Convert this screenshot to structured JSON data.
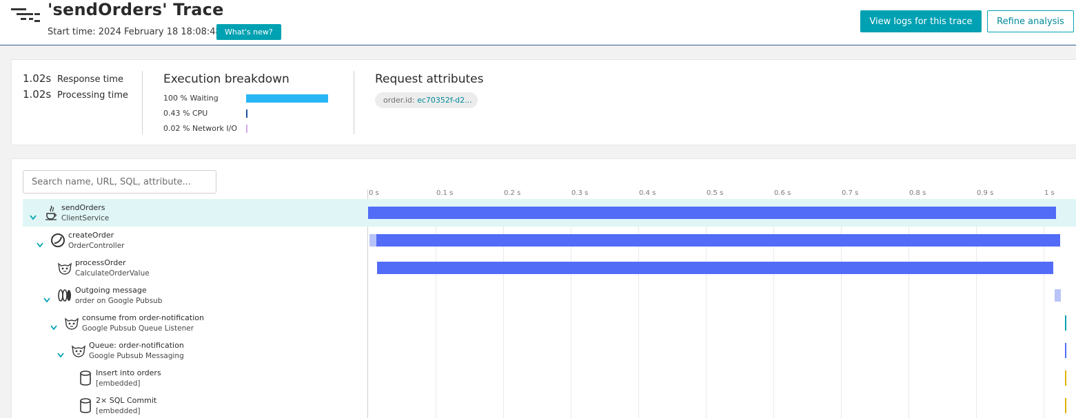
{
  "header": {
    "title": "'sendOrders' Trace",
    "start_time": "Start time: 2024 February 18 18:08:48",
    "whats_new": "What's new?",
    "view_logs": "View logs for this trace",
    "refine": "Refine analysis"
  },
  "summary": {
    "response_value": "1.02s",
    "response_label": "Response time",
    "processing_value": "1.02s",
    "processing_label": "Processing time",
    "breakdown_title": "Execution breakdown",
    "breakdown": [
      {
        "label": "100 % Waiting",
        "fraction": 1.0,
        "color": "#2ab6f4"
      },
      {
        "label": "0.43 % CPU",
        "fraction": 0.0043,
        "color": "#1a4f9c"
      },
      {
        "label": "0.02 % Network I/O",
        "fraction": 0.0002,
        "color": "#d4a8e8"
      }
    ],
    "attributes_title": "Request attributes",
    "attribute_key": "order.id:",
    "attribute_value": "ec70352f-d2..."
  },
  "waterfall": {
    "search_placeholder": "Search name, URL, SQL, attribute...",
    "ticks": [
      "0 s",
      "0.1 s",
      "0.2 s",
      "0.3 s",
      "0.4 s",
      "0.5 s",
      "0.6 s",
      "0.7 s",
      "0.8 s",
      "0.9 s",
      "1 s"
    ],
    "colors": {
      "primary": "#536cf7",
      "light": "#b8c4f8",
      "teal": "#00a1b2",
      "db": "#e0b100"
    },
    "rows": [
      {
        "name": "sendOrders",
        "sub": "ClientService",
        "icon": "java-icon",
        "expanded": true,
        "selected": true,
        "segments": [
          {
            "start": 0.0,
            "end": 1.018,
            "color": "#536cf7"
          }
        ]
      },
      {
        "name": "createOrder",
        "sub": "OrderController",
        "icon": "spring-icon",
        "expanded": true,
        "selected": false,
        "segments": [
          {
            "start": 0.002,
            "end": 0.012,
            "color": "#b8c4f8"
          },
          {
            "start": 0.012,
            "end": 1.024,
            "color": "#536cf7"
          }
        ]
      },
      {
        "name": "processOrder",
        "sub": "CalculateOrderValue",
        "icon": "tomcat-icon",
        "expanded": false,
        "selected": false,
        "segments": [
          {
            "start": 0.013,
            "end": 1.014,
            "color": "#536cf7"
          }
        ]
      },
      {
        "name": "Outgoing message",
        "sub": "order on Google Pubsub",
        "icon": "message-queue-icon",
        "expanded": true,
        "selected": false,
        "segments": [
          {
            "start": 1.016,
            "end": 1.026,
            "color": "#b8c4f8"
          }
        ]
      },
      {
        "name": "consume from order-notification",
        "sub": "Google Pubsub Queue Listener",
        "icon": "tomcat-icon",
        "expanded": true,
        "selected": false,
        "segments": [
          {
            "start": 1.032,
            "end": 1.034,
            "color": "#00a1b2"
          }
        ]
      },
      {
        "name": "Queue: order-notification",
        "sub": "Google Pubsub Messaging",
        "icon": "tomcat-icon",
        "expanded": true,
        "selected": false,
        "segments": [
          {
            "start": 1.032,
            "end": 1.034,
            "color": "#536cf7"
          }
        ]
      },
      {
        "name": "Insert into orders",
        "sub": "[embedded]",
        "icon": "database-icon",
        "expanded": false,
        "selected": false,
        "segments": [
          {
            "start": 1.032,
            "end": 1.034,
            "color": "#e0b100"
          }
        ]
      },
      {
        "name": "2× SQL Commit",
        "sub": "[embedded]",
        "icon": "database-icon",
        "expanded": false,
        "selected": false,
        "segments": [
          {
            "start": 1.032,
            "end": 1.034,
            "color": "#e0b100"
          }
        ]
      }
    ]
  }
}
